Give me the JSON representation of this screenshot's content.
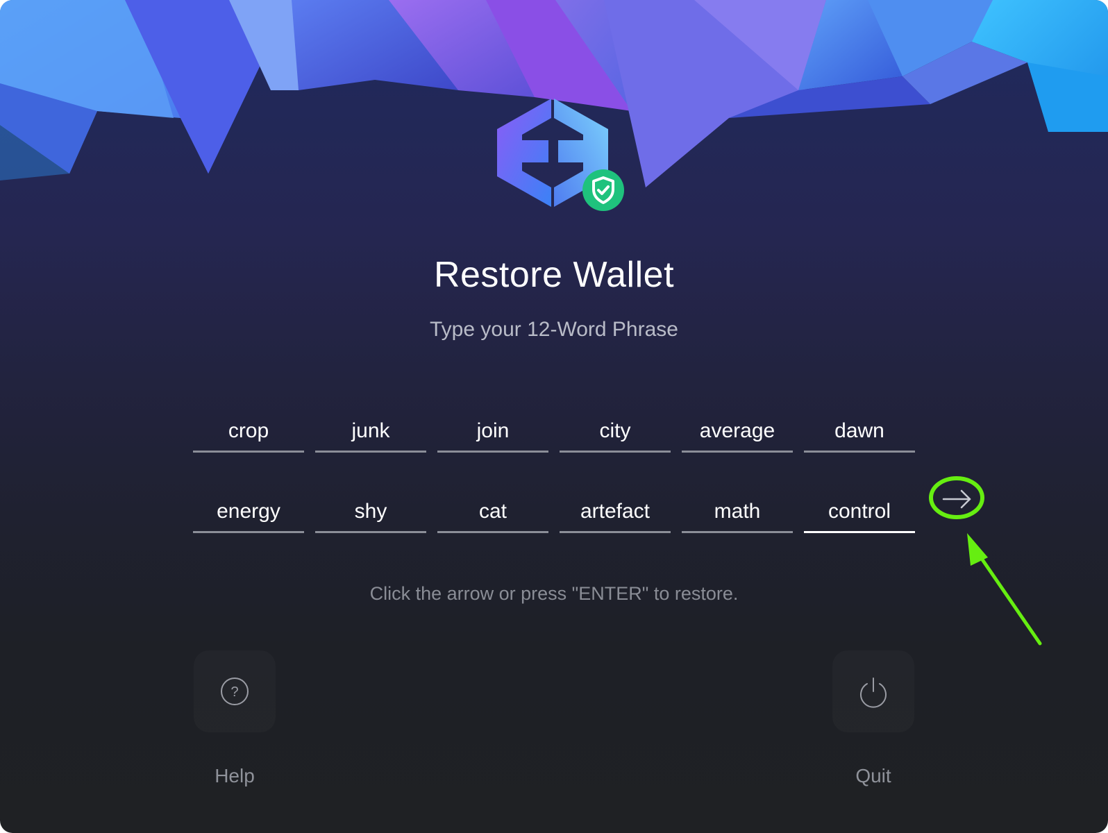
{
  "page": {
    "title": "Restore Wallet",
    "subtitle": "Type your 12-Word Phrase",
    "hint": "Click the arrow or press \"ENTER\" to restore."
  },
  "words": [
    "crop",
    "junk",
    "join",
    "city",
    "average",
    "dawn",
    "energy",
    "shy",
    "cat",
    "artefact",
    "math",
    "control"
  ],
  "active_word_index": 11,
  "actions": {
    "help_label": "Help",
    "help_icon": "question-circle-icon",
    "quit_label": "Quit",
    "quit_icon": "power-icon",
    "submit_icon": "arrow-right-icon"
  },
  "colors": {
    "accent_green": "#1fc27d",
    "annotation_green": "#66ee11",
    "crystal_blue": "#3fa7f2",
    "crystal_purple": "#7b5ce6",
    "active_underline": "#ffffff",
    "inactive_underline": "#8b8e98"
  }
}
